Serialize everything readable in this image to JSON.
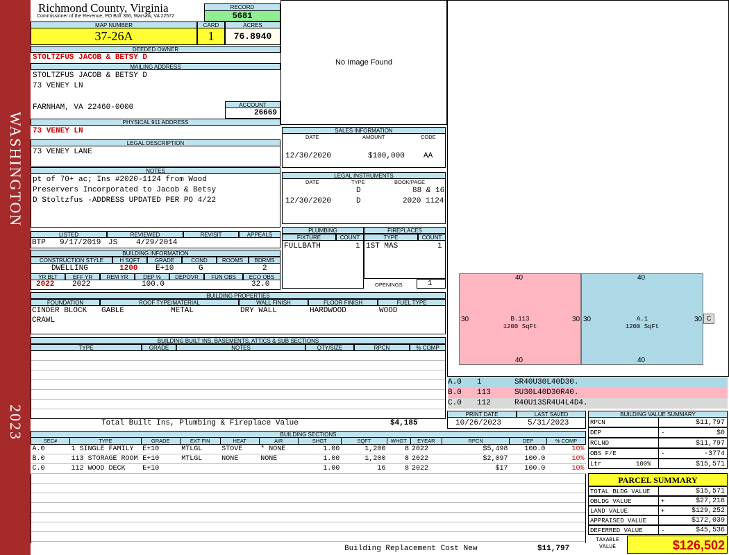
{
  "side": {
    "county_label": "WASHINGTON",
    "year": "2023"
  },
  "header": {
    "county": "Richmond County, Virginia",
    "address": "Commissioner of the Revenue, PO Box 366, Warsaw, VA 22572",
    "record_label": "RECORD",
    "record": "5681",
    "map_label": "MAP NUMBER",
    "map": "37-26A",
    "card_label": "CARD",
    "card": "1",
    "acres_label": "ACRES",
    "acres": "76.8940"
  },
  "owner": {
    "deeded_label": "DEEDED OWNER",
    "deeded": "STOLTZFUS JACOB & BETSY D",
    "mailing_label": "MAILING ADDRESS",
    "mail1": "STOLTZFUS JACOB & BETSY D",
    "mail2": "73 VENEY LN",
    "mail3": "",
    "mail4": "FARNHAM, VA 22460-0000",
    "account_label": "ACCOUNT",
    "account": "26669",
    "phys_label": "PHYSICAL 911 ADDRESS",
    "phys": "73 VENEY LN",
    "legal_label": "LEGAL DESCRIPTION",
    "legal": "73 VENEY LANE",
    "notes_label": "NOTES",
    "notes1": "pt of 70+ ac; Ins #2020-1124 from Wood",
    "notes2": "Preservers Incorporated to Jacob & Betsy",
    "notes3": "D Stoltzfus -ADDRESS UPDATED PER PO 4/22"
  },
  "image": {
    "text": "No Image Found"
  },
  "sales": {
    "title": "SALES INFORMATION",
    "date_h": "DATE",
    "amount_h": "AMOUNT",
    "code_h": "CODE",
    "date": "12/30/2020",
    "amount": "$100,000",
    "code": "AA"
  },
  "legal_instruments": {
    "title": "LEGAL INSTRUMENTS",
    "date_h": "DATE",
    "type_h": "TYPE",
    "book_h": "BOOK/PAGE",
    "r1_type": "D",
    "r1_book": "88 & 16",
    "r2_date": "12/30/2020",
    "r2_type": "D",
    "r2_book": "2020 1124"
  },
  "plumbing": {
    "title": "PLUMBING",
    "fixture_h": "FIXTURE",
    "count_h": "COUNT",
    "fixture": "FULLBATH",
    "count": "1"
  },
  "fireplaces": {
    "title": "FIREPLACES",
    "type_h": "TYPE",
    "count_h": "COUNT",
    "type": "1ST MAS",
    "count": "1",
    "openings_label": "OPENINGS",
    "openings": "1"
  },
  "listing": {
    "listed_h": "LISTED",
    "reviewed_h": "REVIEWED",
    "revisit_h": "REVISIT",
    "appeals_h": "APPEALS",
    "listed_by": "BTP",
    "listed_date": "9/17/2019",
    "reviewed_by": "JS",
    "reviewed_date": "4/29/2014"
  },
  "building_info": {
    "title": "BUILDING INFORMATION",
    "style_h": "CONSTRUCTION STYLE",
    "hsqft_h": "H SQFT",
    "grade_h": "GRADE",
    "cond_h": "COND",
    "rooms_h": "ROOMS",
    "bdrms_h": "BDRMS",
    "style": "DWELLING",
    "hsqft": "1200",
    "grade": "E+10",
    "cond": "G",
    "rooms": "",
    "bdrms": "2",
    "yrblt_h": "YR BLT",
    "effyr_h": "EFF YR",
    "remyr_h": "REM YR",
    "dep_h": "DEP %",
    "depovr_h": "DEPOVR",
    "funobs_h": "FUN OBS",
    "ecoobs_h": "ECO OBS",
    "yrblt": "2022",
    "effyr": "2022",
    "dep": "100.0",
    "ecoobs": "32.0"
  },
  "properties": {
    "title": "BUILDING PROPERTIES",
    "foundation_h": "FOUNDATION",
    "roof_h": "ROOF TYPE/MATERIAL",
    "wall_h": "WALL FINISH",
    "floor_h": "FLOOR FINISH",
    "fuel_h": "FUEL TYPE",
    "foundation1": "CINDER BLOCK",
    "foundation2": "CRAWL",
    "roof_type": "GABLE",
    "roof_mat": "METAL",
    "wall": "DRY WALL",
    "floor": "HARDWOOD",
    "fuel": "WOOD"
  },
  "builtins": {
    "title": "BUILDING BUILT INS, BASEMENTS, ATTICS & SUB SECTIONS",
    "type_h": "TYPE",
    "grade_h": "GRADE",
    "notes_h": "NOTES",
    "qty_h": "QTY/SIZE",
    "rpcn_h": "RPCN",
    "comp_h": "% COMP",
    "total_label": "Total Built Ins, Plumbing & Fireplace Value",
    "total": "$4,185"
  },
  "sketch": {
    "rect_b_label": "B.113",
    "rect_b_area": "1200 SqFt",
    "rect_a_label": "A.1",
    "rect_a_area": "1200 SqFt",
    "dim_top_b": "40",
    "dim_bottom_b": "40",
    "dim_left_b": "30",
    "dim_right_b": "30",
    "dim_top_a": "40",
    "dim_bottom_a": "40",
    "dim_left_a": "30",
    "dim_right_a": "30",
    "small_c": "C",
    "color_a": "#add8e6",
    "color_b": "#ffb6c1"
  },
  "sketch_legend": [
    {
      "sec": "A.0",
      "code": "1",
      "desc": "SR40U30L40D30.",
      "color": "#add8e6"
    },
    {
      "sec": "B.0",
      "code": "113",
      "desc": "SU30L40D30R40.",
      "color": "#ffb6c1"
    },
    {
      "sec": "C.0",
      "code": "112",
      "desc": "R40U13SR4U4L4D4.",
      "color": "#d9d9d9"
    }
  ],
  "dates": {
    "print_h": "PRINT DATE",
    "saved_h": "LAST SAVED",
    "print": "10/26/2023",
    "saved": "5/31/2023"
  },
  "sections": {
    "title": "BUILDING SECTIONS",
    "headers": [
      "SEC#",
      "TYPE",
      "GRADE",
      "EXT FIN",
      "HEAT",
      "AIR",
      "SHGT",
      "SQFT",
      "WHGT",
      "EYEAR",
      "RPCN",
      "DEP",
      "% COMP"
    ],
    "rows": [
      [
        "A.0",
        "1 SINGLE FAMILY",
        "E+10",
        "MTLGL",
        "STOVE",
        "* NONE",
        "1.00",
        "1,200",
        "8",
        "2022",
        "$5,498",
        "100.0",
        "10%"
      ],
      [
        "B.0",
        "113 STORAGE ROOM",
        "E+10",
        "MTLGL",
        "NONE",
        "NONE",
        "1.00",
        "1,200",
        "8",
        "2022",
        "$2,097",
        "100.0",
        "10%"
      ],
      [
        "C.0",
        "112 WOOD DECK",
        "E+10",
        "",
        "",
        "",
        "1.00",
        "16",
        "8",
        "2022",
        "$17",
        "100.0",
        "10%"
      ]
    ],
    "rc_label": "Building Replacement Cost New",
    "rc_value": "$11,797"
  },
  "value_summary": {
    "title": "BUILDING VALUE SUMMARY",
    "rows": [
      {
        "label": "RPCN",
        "sign": "",
        "value": "$11,797"
      },
      {
        "label": "DEP",
        "sign": "-",
        "value": "$0"
      },
      {
        "label": "RCLND",
        "sign": "",
        "value": "$11,797"
      },
      {
        "label": "OBS F/E",
        "sign": "-",
        "value": "-3774"
      },
      {
        "label": "Ltr",
        "sign": "100%",
        "value": "$15,571"
      }
    ]
  },
  "parcel": {
    "title": "PARCEL SUMMARY",
    "rows": [
      {
        "label": "TOTAL BLDG VALUE",
        "sign": "",
        "value": "$15,571"
      },
      {
        "label": "OBLDG VALUE",
        "sign": "+",
        "value": "$27,216"
      },
      {
        "label": "LAND VALUE",
        "sign": "+",
        "value": "$129,252"
      },
      {
        "label": "APPRAISED VALUE",
        "sign": "",
        "value": "$172,039"
      },
      {
        "label": "DEFERRED VALUE",
        "sign": "-",
        "value": "$45,536"
      }
    ],
    "taxable_label": "TAXABLE VALUE",
    "taxable": "$126,502"
  }
}
